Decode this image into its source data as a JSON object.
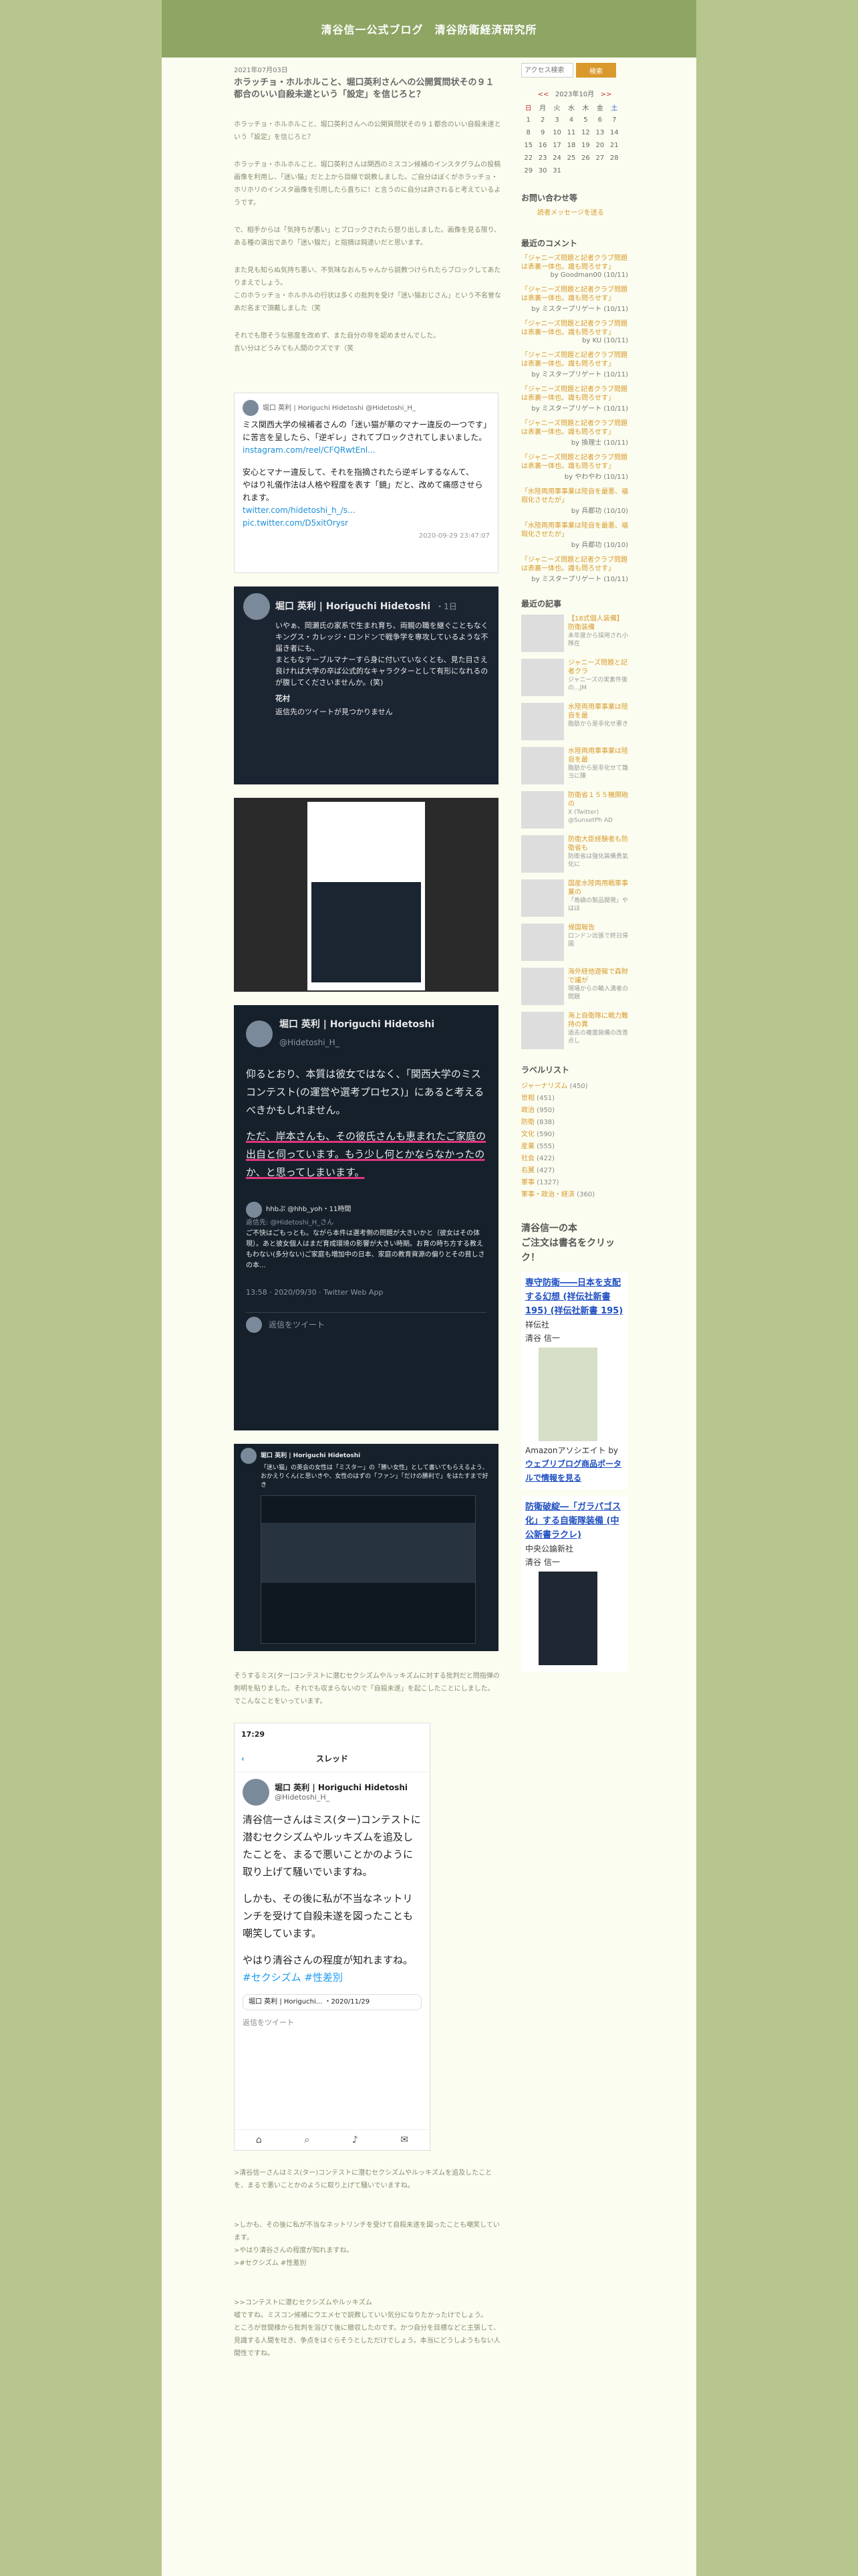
{
  "site_title": "清谷信一公式ブログ　清谷防衛経済研究所",
  "post": {
    "date": "2021年07月03日",
    "title": "ホラッチョ・ホルホルこと、堀口英利さんへの公開質問状その９１都合のいい自殺未遂という「設定」を信じろと？",
    "p1": "ホラッチョ・ホルホルこと、堀口英利さんへの公開質問状その９１都合のいい自殺未遂という「設定」を信じろと？",
    "p2": "ホラッチョ・ホルホルこと、堀口英利さんは関西のミスコン候補のインスタグラムの投稿画像を利用し、「迷い猫」だと上から目線で説教しました。ご自分はぼくがホラッチョ・ホリホリのインスタ画像を引用したら直ちに！と言うのに自分は許されると考えているようです。",
    "p3": "で、相手からは「気持ちが悪い」とブロックされたら怒り出しました。画像を見る限り、ある種の演出であり「迷い猫だ」と指摘は鈍違いだと思います。",
    "p4": "また見も知らぬ気持ち悪い、不気味なおんちゃんから説教つけられたらブロックしてあたりまえでしょう。\nこのホラッチョ・ホルホルの行状は多くの批判を受け「迷い猫おじさん」という不名誉なあだ名まで頂戴しました（笑",
    "p5": "それでも懲そうな態度を改めず、また自分の非を認めませんでした。\n言い分はどうみても人間のクズです（笑",
    "p6": "そうするミス[ター]コンテストに潜むセクシズムやルッキズムに対する批判だと問指弾の\n刺明を貼りました。それでも収まらないので「自殺未遂」を起こしたことにしました。\nでこんなことをいっています。",
    "p7": ">清谷信一さんはミス(ター)コンテストに潜むセクシズムやルッキズムを追及したことを、まるで悪いことかのように取り上げて騒いでいますね。",
    "p8": ">しかも、その後に私が不当なネットリンチを受けて自殺未遂を図ったことも嘲笑しています。\n>やはり清谷さんの程度が知れますね。\n>#セクシズム #性差別",
    "p9": ">>コンテストに潜むセクシズムやルッキズム\n嘘ですね。ミスコン候補にウエメセで説教していい気分になりたかったけでしょう。\nところが世間様から批判を浴びて後に撤収したのです。かつ自分を目標などと主張して、見識する人間を吐き、争点をはぐらそうとしただけでしょう。本当にどうしようもない人間性ですね。"
  },
  "tweet1": {
    "author": "堀口 英利 | Horiguchi Hidetoshi @Hidetoshi_H_",
    "text_a": "ミス関西大学の候補者さんの「迷い猫が華のマナー違反の一つです」に苦言を呈したら、「逆ギレ」されてブロックされてしまいました。",
    "link_a": "instagram.com/reel/CFQRwtEnl...",
    "text_b": "安心とマナー違反して、それを指摘されたら逆ギレするなんて、\nやはり礼儀作法は人格や程度を表す「鏡」だと、改めて痛感させられます。",
    "link_b": "twitter.com/hidetoshi_h_/s...",
    "link_c": "pic.twitter.com/D5xitOrysr",
    "time": "2020-09-29 23:47:07"
  },
  "tweet2": {
    "name": "堀口 英利 | Horiguchi Hidetoshi",
    "meta": "・1日",
    "text": "いやぁ、岡瀬氏の家系で生まれ育ち、両親の職を継ぐこともなくキングス・カレッジ・ロンドンで戦争学を専攻しているような不届き者にも、\nまともなテーブルマナーすら身に付いていなくとも、見た目さえ良ければ大学の卒ば公式的なキャラクターとして有形になれるのが腹してくださいませんか。(笑)",
    "reply_name": "花村",
    "reply_text": "返信先のツイートが見つかりません"
  },
  "tweet4": {
    "name": "堀口 英利 | Horiguchi Hidetoshi",
    "handle": "@Hidetoshi_H_",
    "text_a": "仰るとおり、本質は彼女ではなく、「関西大学のミスコンテスト(の運営や選考プロセス)」にあると考えるべきかもしれません。",
    "text_b": "ただ、岸本さんも、その彼氏さんも恵まれたご家庭の出自と伺っています。もう少し何とかならなかったのか、と思ってしまいます。",
    "reply_user": "hhbぷ @hhb_yoh・11時間",
    "reply_to": "返信先: @Hidetoshi_H_さん",
    "reply_text": "ご不快はごもっとも。ながら本件は選考側の問題が大きいかと（彼女はその体現）。あと彼女個人はまだ育成環境の影響が大きい時期。お育の時ち方する教えもわない(多分ない)ご家庭も増加中の日本、家庭の教育資源の偏りとその貧しさの本...",
    "time": "13:58 · 2020/09/30 · Twitter Web App",
    "reply_placeholder": "返信をツイート"
  },
  "tweet5": {
    "name": "堀口 英利 | Horiguchi Hidetoshi",
    "text": "「迷い猫」の英会の女性は「ミスター」の「勝い女性」として書いてもらえるよう、おかえりくん(と思いきや、女性のはずの「ファン」「だけの勝利で」をはたすまで好き"
  },
  "tweet6": {
    "time": "17:29",
    "header": "スレッド",
    "name": "堀口 英利 | Horiguchi Hidetoshi",
    "handle": "@Hidetoshi_H_",
    "text_a": "清谷信一さんはミス(ター)コンテストに潜むセクシズムやルッキズムを追及したことを、まるで悪いことかのように取り上げて騒いでいますね。",
    "text_b": "しかも、その後に私が不当なネットリンチを受けて自殺未遂を図ったことも嘲笑しています。",
    "text_c": "やはり清谷さんの程度が知れますね。",
    "tags": "#セクシズム #性差別",
    "quote": "堀口 英利 | Horiguchi... ・2020/11/29",
    "reply_placeholder": "返信をツイート"
  },
  "sidebar": {
    "search_placeholder": "アクセス検索",
    "search_button": "検索",
    "cal_prev": "<<",
    "cal_title": "2023年10月",
    "cal_next": ">>",
    "weekdays": [
      "日",
      "月",
      "火",
      "水",
      "木",
      "金",
      "土"
    ],
    "weeks": [
      [
        "1",
        "2",
        "3",
        "4",
        "5",
        "6",
        "7"
      ],
      [
        "8",
        "9",
        "10",
        "11",
        "12",
        "13",
        "14"
      ],
      [
        "15",
        "16",
        "17",
        "18",
        "19",
        "20",
        "21"
      ],
      [
        "22",
        "23",
        "24",
        "25",
        "26",
        "27",
        "28"
      ],
      [
        "29",
        "30",
        "31",
        "",
        "",
        "",
        "",
        ""
      ]
    ],
    "contact_heading": "お問い合わせ等",
    "contact_link": "読者メッセージを送る",
    "comments_heading": "最近のコメント",
    "comments": [
      {
        "title": "「ジャニーズ問題と記者クラブ問題は表裏一体也。識も問ろせす」",
        "by": "by Goodman00 (10/11)"
      },
      {
        "title": "「ジャニーズ問題と記者クラブ問題は表裏一体也。識も問ろせす」",
        "by": "by ミスタープリゲート (10/11)"
      },
      {
        "title": "「ジャニーズ問題と記者クラブ問題は表裏一体也。識も問ろせす」",
        "by": "by KU (10/11)"
      },
      {
        "title": "「ジャニーズ問題と記者クラブ問題は表裏一体也。識も問ろせす」",
        "by": "by ミスタープリゲート (10/11)"
      },
      {
        "title": "「ジャニーズ問題と記者クラブ問題は表裏一体也。識も問ろせす」",
        "by": "by ミスタープリゲート (10/11)"
      },
      {
        "title": "「ジャニーズ問題と記者クラブ問題は表裏一体也。識も問ろせす」",
        "by": "by 換理士 (10/11)"
      },
      {
        "title": "「ジャニーズ問題と記者クラブ問題は表裏一体也。識も問ろせす」",
        "by": "by やわやわ (10/11)"
      },
      {
        "title": "「水陸両用車事業は陸自を最悪、福瑕化させたが」",
        "by": "by 兵都功 (10/10)"
      },
      {
        "title": "「水陸両用車事業は陸自を最悪、福瑕化させたが」",
        "by": "by 兵都功 (10/10)"
      },
      {
        "title": "「ジャニーズ問題と記者クラブ問題は表裏一体也。識も問ろせす」",
        "by": "by ミスタープリゲート (10/11)"
      }
    ],
    "articles_heading": "最近の記事",
    "articles": [
      {
        "title": "【18式個人装備】防衛装備",
        "sub": "未年度から採用され小隊在"
      },
      {
        "title": "ジャニーズ問題と記者クラ",
        "sub": "ジャニーズの実素件後の...JM"
      },
      {
        "title": "水陸両用車事業は陸自を最",
        "sub": "脂肪から是非化せ悪き"
      },
      {
        "title": "水陸両用車事業は陸自を最",
        "sub": "脂肪から是非化せて雛ヨに陳"
      },
      {
        "title": "防衛省１５５機関砲の",
        "sub": "X (Twitter) @SunsetPh AD"
      },
      {
        "title": "防衛大臣経験者も防衛省も",
        "sub": "防衛省は強化装備勇氣化に"
      },
      {
        "title": "国産水陸両用戦車事業の",
        "sub": "「島嶼の製品開発」やはほ"
      },
      {
        "title": "帰国報告",
        "sub": "ロンドン出張で終日帰国"
      },
      {
        "title": "海外経他遊報で森財で議が",
        "sub": "現場からの輸入満者の問題"
      },
      {
        "title": "海上自衛隊に戦力難持の異",
        "sub": "過去の複面装備の改善点し"
      }
    ],
    "labels_heading": "ラベルリスト",
    "labels": [
      {
        "name": "ジャーナリズム",
        "count": "(450)"
      },
      {
        "name": "世相",
        "count": "(451)"
      },
      {
        "name": "政治",
        "count": "(950)"
      },
      {
        "name": "防衛",
        "count": "(838)"
      },
      {
        "name": "文化",
        "count": "(590)"
      },
      {
        "name": "産業",
        "count": "(555)"
      },
      {
        "name": "社会",
        "count": "(422)"
      },
      {
        "name": "右翼",
        "count": "(427)"
      },
      {
        "name": "軍事",
        "count": "(1327)"
      },
      {
        "name": "軍事・政治・経済",
        "count": "(360)"
      }
    ],
    "books_heading": "清谷信一の本\nご注文は書名をクリック！",
    "book1_title": "専守防衛――日本を支配する幻想 (祥伝社新書195) (祥伝社新書 195)",
    "book1_pub": "祥伝社",
    "book1_author": "清谷 信一",
    "amazon_credit": "Amazonアソシエイト by",
    "amazon_link": "ウェブリブログ商品ポータルで情報を見る",
    "book2_title": "防衛破綻―「ガラパゴス化」する自衛隊装備 (中公新書ラクレ)",
    "book2_pub": "中央公論新社",
    "book2_author": "清谷 信一"
  }
}
